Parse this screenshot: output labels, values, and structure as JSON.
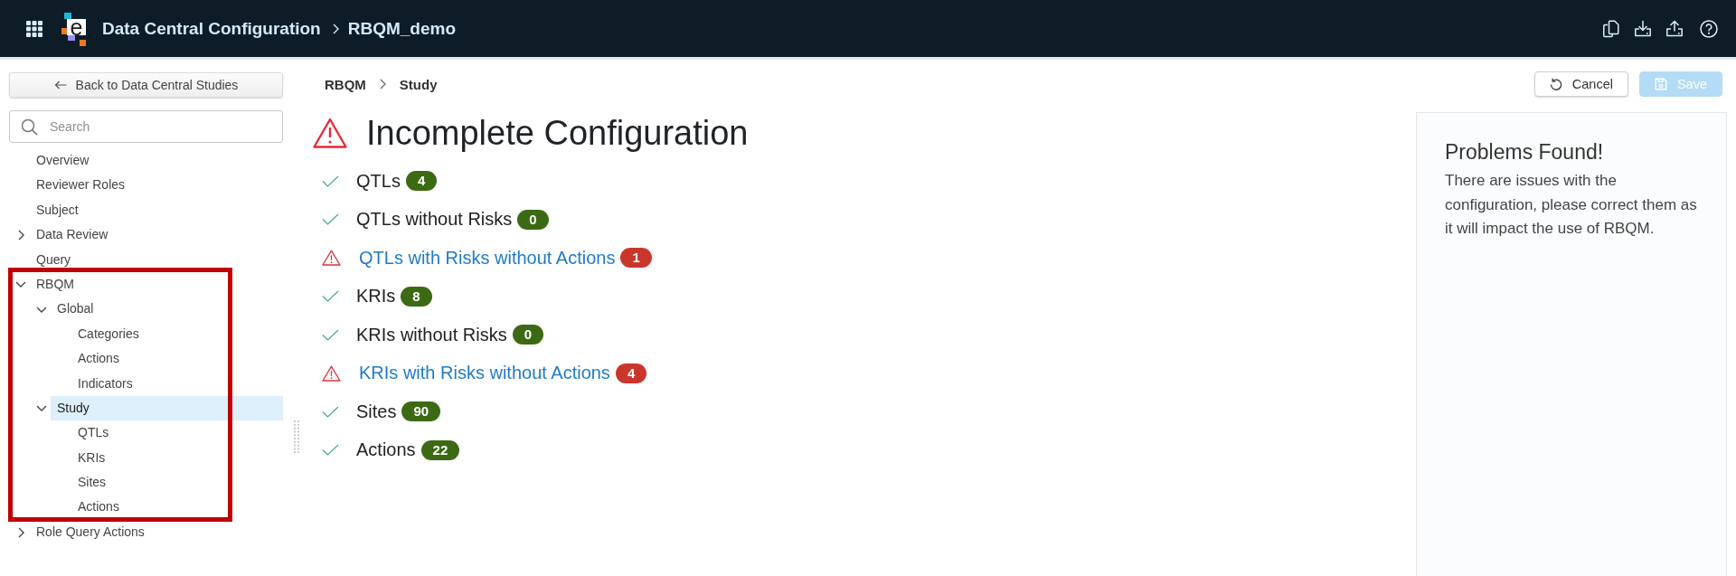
{
  "header": {
    "logo_letter": "e",
    "app_title": "Data Central Configuration",
    "study_name": "RBQM_demo"
  },
  "sidebar": {
    "back_button": "Back to Data Central Studies",
    "search": {
      "placeholder": "Search"
    },
    "tree": [
      {
        "label": "Overview",
        "selected": false,
        "highlighted": false
      },
      {
        "label": "Reviewer Roles",
        "selected": false,
        "highlighted": false
      },
      {
        "label": "Subject",
        "selected": false,
        "highlighted": false
      },
      {
        "label": "Data Review",
        "selected": false,
        "highlighted": false,
        "expanded": false
      },
      {
        "label": "Query",
        "selected": false,
        "highlighted": false
      },
      {
        "label": "RBQM",
        "selected": false,
        "highlighted": true,
        "expanded": true,
        "children": [
          {
            "label": "Global",
            "selected": false,
            "expanded": true,
            "children": [
              {
                "label": "Categories",
                "selected": false
              },
              {
                "label": "Actions",
                "selected": false
              },
              {
                "label": "Indicators",
                "selected": false
              }
            ]
          },
          {
            "label": "Study",
            "selected": true,
            "expanded": true,
            "children": [
              {
                "label": "QTLs",
                "selected": false
              },
              {
                "label": "KRIs",
                "selected": false
              },
              {
                "label": "Sites",
                "selected": false
              },
              {
                "label": "Actions",
                "selected": false
              }
            ]
          }
        ]
      },
      {
        "label": "Role Query Actions",
        "selected": false,
        "highlighted": false,
        "expanded": false
      }
    ]
  },
  "main": {
    "breadcrumb": [
      "RBQM",
      "Study"
    ],
    "actions": [
      {
        "kind": "cancel",
        "label": "Cancel",
        "disabled": false
      },
      {
        "kind": "save",
        "label": "Save",
        "disabled": true
      }
    ],
    "status": {
      "kind": "warning",
      "title": "Incomplete Configuration"
    },
    "checks": [
      {
        "kind": "ok",
        "label": "QTLs",
        "count": "4"
      },
      {
        "kind": "ok",
        "label": "QTLs without Risks",
        "count": "0"
      },
      {
        "kind": "warning",
        "label": "QTLs with Risks without Actions",
        "count": "1"
      },
      {
        "kind": "ok",
        "label": "KRIs",
        "count": "8"
      },
      {
        "kind": "ok",
        "label": "KRIs without Risks",
        "count": "0"
      },
      {
        "kind": "warning",
        "label": "KRIs with Risks without Actions",
        "count": "4"
      },
      {
        "kind": "ok",
        "label": "Sites",
        "count": "90"
      },
      {
        "kind": "ok",
        "label": "Actions",
        "count": "22"
      }
    ]
  },
  "problems_panel": {
    "title": "Problems Found!",
    "message": "There are issues with the configuration, please correct them as it will impact the use of RBQM."
  }
}
